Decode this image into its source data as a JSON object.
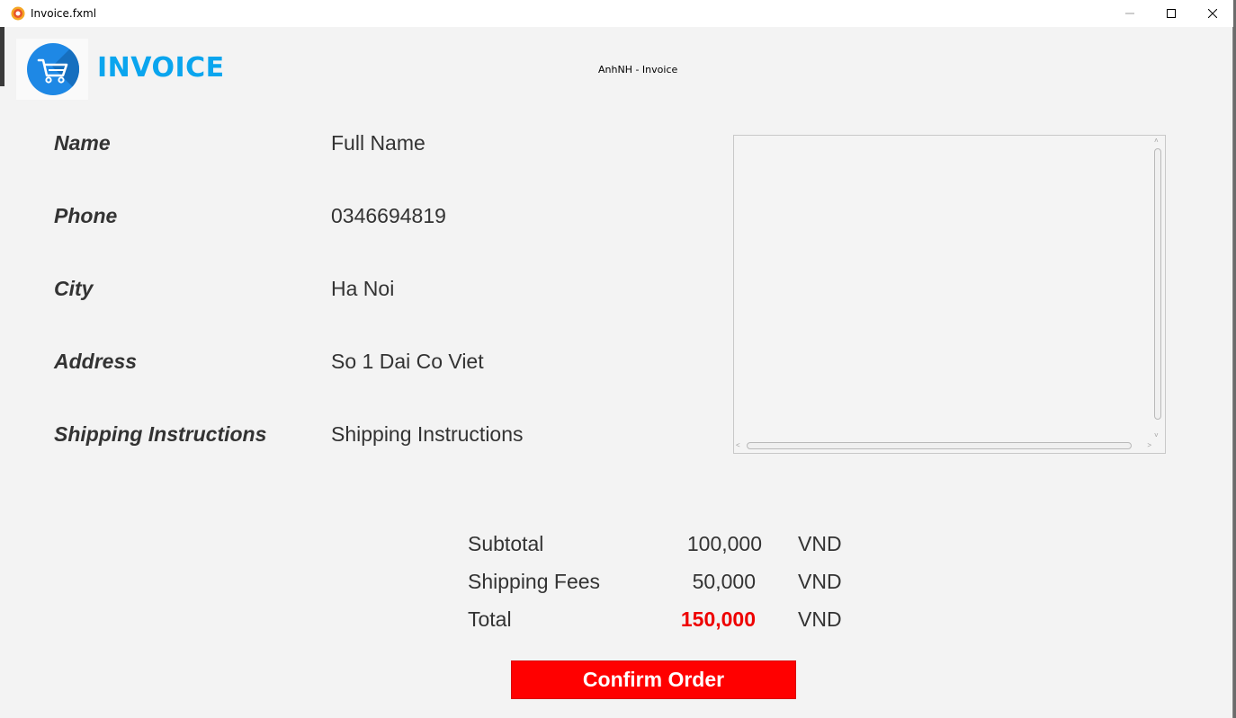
{
  "window": {
    "title": "Invoice.fxml"
  },
  "header": {
    "logo_icon": "shopping-cart-icon",
    "heading": "INVOICE",
    "subtitle": "AnhNH - Invoice"
  },
  "fields": [
    {
      "label": "Name",
      "value": "Full Name"
    },
    {
      "label": "Phone",
      "value": "0346694819"
    },
    {
      "label": "City",
      "value": "Ha Noi"
    },
    {
      "label": "Address",
      "value": "So 1 Dai Co Viet"
    },
    {
      "label": "Shipping Instructions",
      "value": "Shipping Instructions"
    }
  ],
  "summary": {
    "subtotal_label": "Subtotal",
    "subtotal_value": "100,000",
    "shipping_label": "Shipping Fees",
    "shipping_value": "50,000",
    "total_label": "Total",
    "total_value": "150,000",
    "currency": "VND"
  },
  "actions": {
    "confirm_label": "Confirm Order"
  },
  "colors": {
    "heading": "#0aa5ee",
    "logo": "#1e88e5",
    "total": "#ee0000",
    "confirm_button": "#ff0000"
  }
}
